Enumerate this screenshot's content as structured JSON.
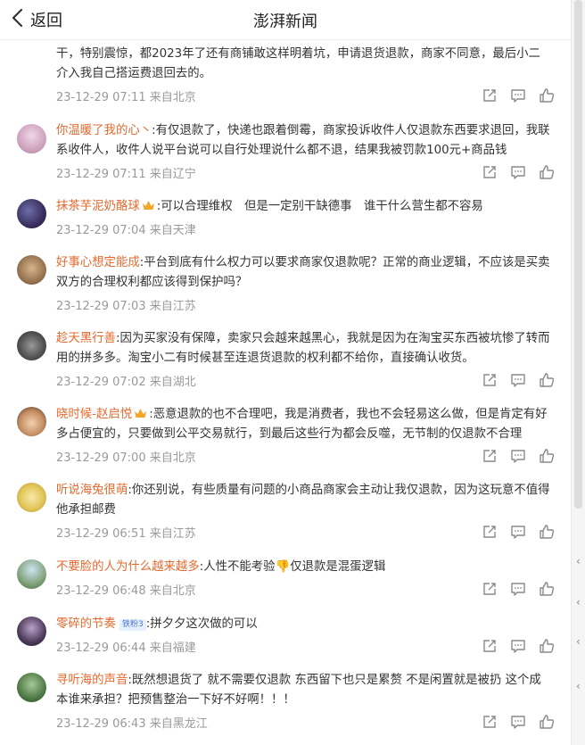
{
  "header": {
    "back_label": "返回",
    "title": "澎湃新闻"
  },
  "comments": [
    {
      "name": "",
      "text": "干，特别震惊，都2023年了还有商铺敢这样明着坑，申请退货退款，商家不同意，最后小二介入我自己搭运费退回去的。",
      "time": "23-12-29 07:11",
      "location": "来自北京"
    },
    {
      "name": "你温暖了我的心丶",
      "text": ":有仅退款了，快递也跟着倒霉，商家投诉收件人仅退款东西要求退回，我联系收件人，收件人说平台说可以自行处理说什么都不退，结果我被罚款100元+商品钱",
      "time": "23-12-29 07:11",
      "location": "来自辽宁"
    },
    {
      "name": "抹茶芋泥奶酪球",
      "text": ":可以合理维权　但是一定别干缺德事　谁干什么营生都不容易",
      "time": "23-12-29 07:04",
      "location": "来自天津"
    },
    {
      "name": "好事心想定能成",
      "text": ":平台到底有什么权力可以要求商家仅退款呢？正常的商业逻辑，不应该是买卖双方的合理权利都应该得到保护吗？",
      "time": "23-12-29 07:03",
      "location": "来自江苏"
    },
    {
      "name": "趁天黑行善",
      "text": ":因为买家没有保障，卖家只会越来越黑心，我就是因为在淘宝买东西被坑惨了转而用的拼多多。淘宝小二有时候甚至连退货退款的权利都不给你，直接确认收货。",
      "time": "23-12-29 07:02",
      "location": "来自湖北"
    },
    {
      "name": "晓时候-赵启悦",
      "text": ":恶意退款的也不合理吧，我是消费者，我也不会轻易这么做，但是肯定有好多占便宜的，只要做到公平交易就行，到最后这些行为都会反噬，无节制的仅退款不合理",
      "time": "23-12-29 07:00",
      "location": "来自北京"
    },
    {
      "name": "听说海兔很萌",
      "text": ":你还别说，有些质量有问题的小商品商家会主动让我仅退款，因为这玩意不值得他承担邮费",
      "time": "23-12-29 06:51",
      "location": "来自江苏"
    },
    {
      "name": "不要脸的人为什么越来越多",
      "text": ":人性不能考验👎仅退款是混蛋逻辑",
      "time": "23-12-29 06:48",
      "location": "来自北京"
    },
    {
      "name": "零碎的节奏",
      "badge": "铁粉3",
      "text": ":拼夕夕这次做的可以",
      "time": "23-12-29 06:44",
      "location": "来自福建"
    },
    {
      "name": "寻听海的声音",
      "text": ":既然想退货了 就不需要仅退款 东西留下也只是累赘 不是闲置就是被扔 这个成本谁来承担？把预售整治一下好不好啊！！！",
      "time": "23-12-29 06:43",
      "location": "来自黑龙江"
    }
  ],
  "icons": {
    "share": "share-icon",
    "reply": "comment-icon",
    "like": "thumbs-up-icon",
    "back": "chevron-left-icon"
  },
  "colors": {
    "name": "#e46a2e",
    "meta": "#9a9a9a",
    "text": "#333333",
    "badge_bg": "#e7f0ff",
    "badge_text": "#4b77d1"
  }
}
